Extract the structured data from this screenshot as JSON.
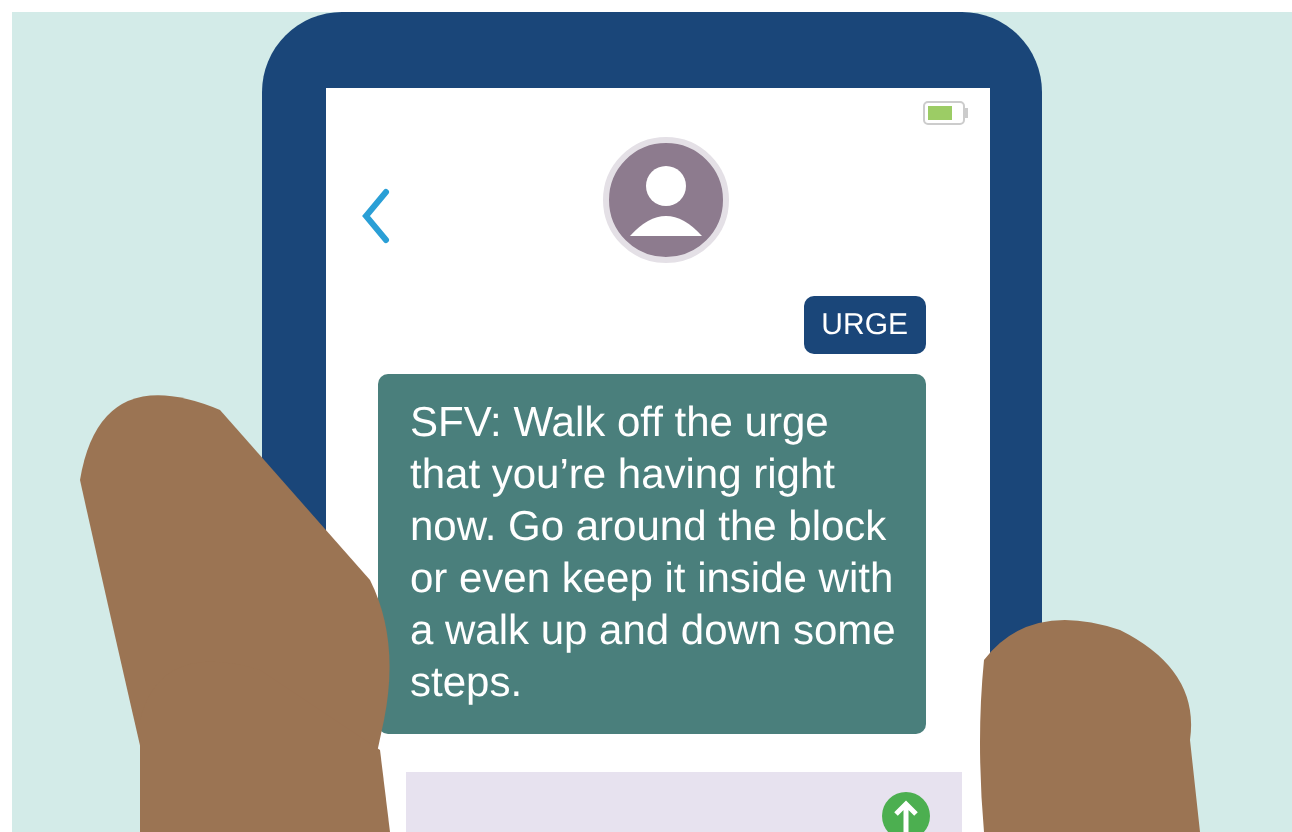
{
  "chat": {
    "tag": "URGE",
    "message": "SFV: Walk off the urge that you’re having right now. Go around the block or even keep it inside with a walk up and down some steps."
  }
}
